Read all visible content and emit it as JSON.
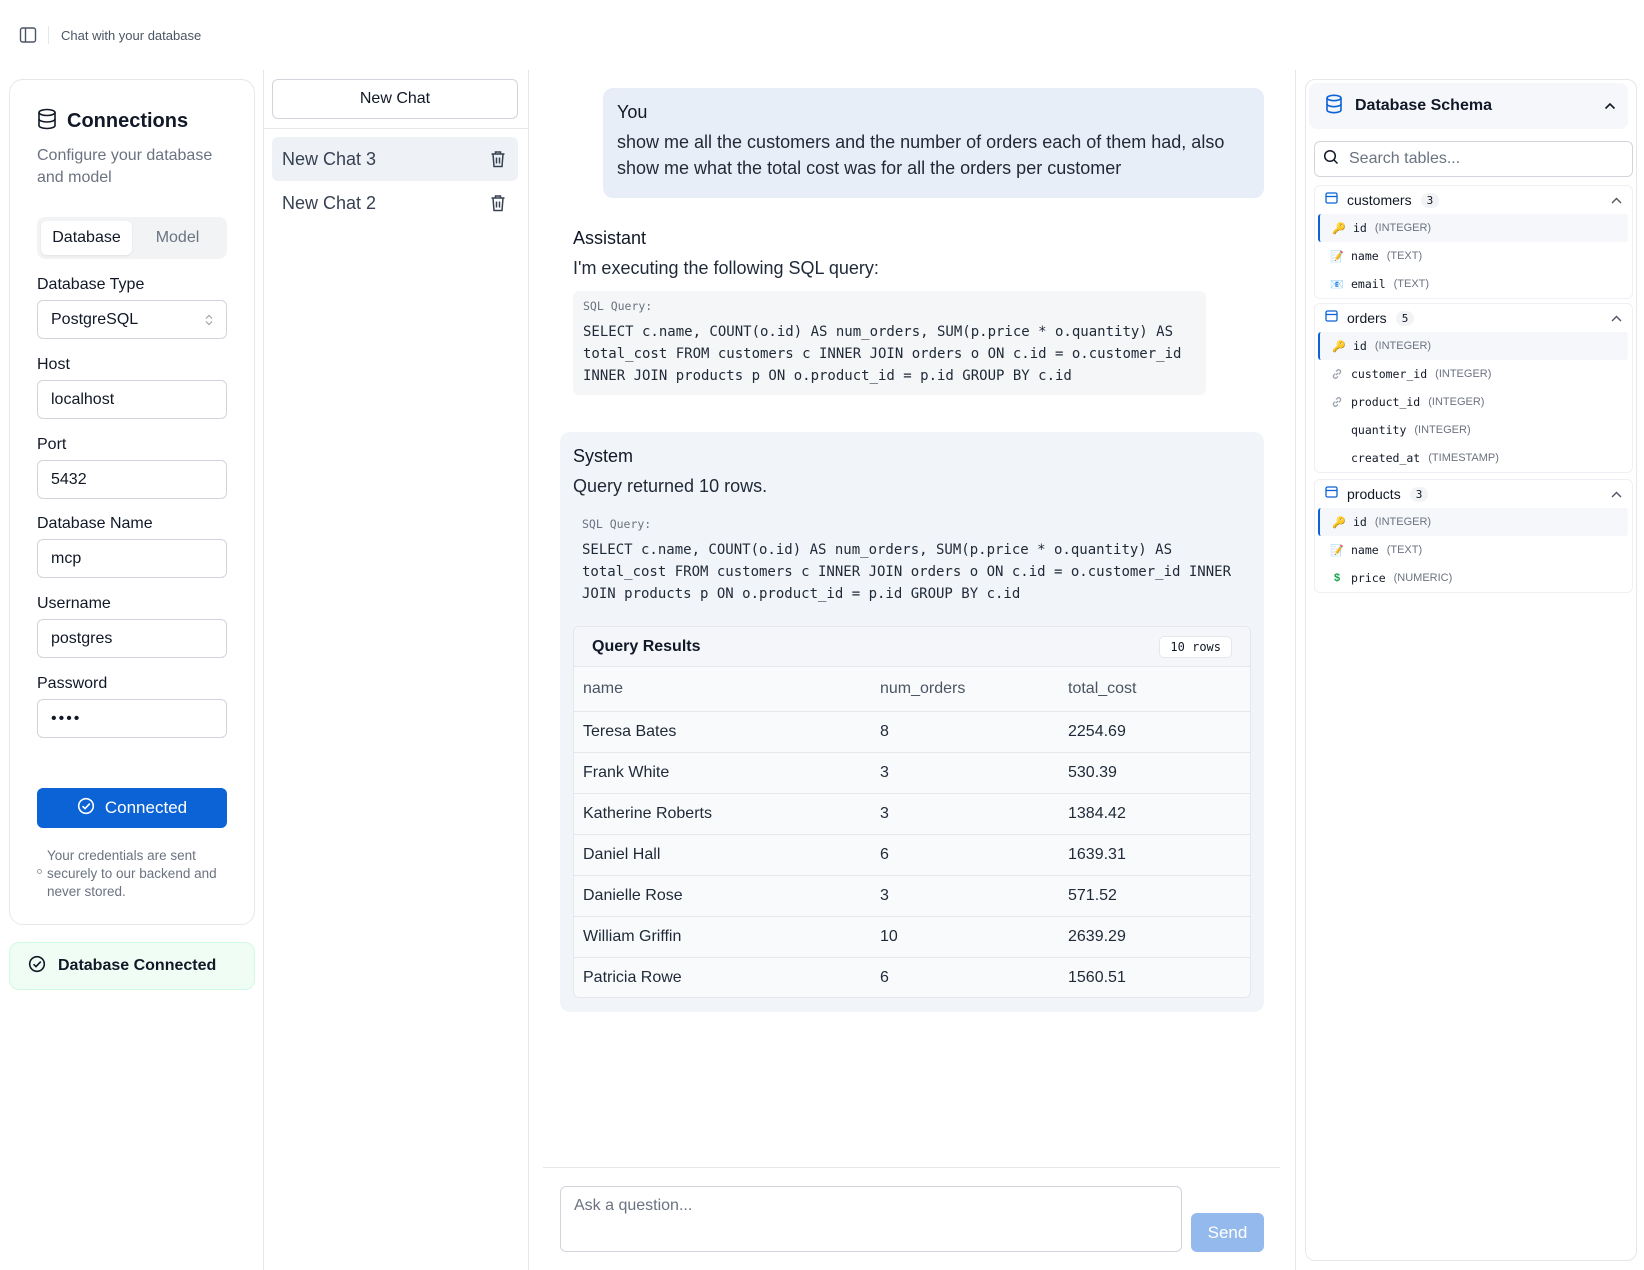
{
  "app": {
    "title": "Chat with your database"
  },
  "connections": {
    "title": "Connections",
    "subtitle": "Configure your database and model",
    "tabs": [
      "Database",
      "Model"
    ],
    "fields": {
      "db_type_label": "Database Type",
      "db_type_value": "PostgreSQL",
      "host_label": "Host",
      "host_value": "localhost",
      "port_label": "Port",
      "port_value": "5432",
      "dbname_label": "Database Name",
      "dbname_value": "mcp",
      "user_label": "Username",
      "user_value": "postgres",
      "password_label": "Password",
      "password_value": "••••"
    },
    "connect_button": "Connected",
    "note": "Your credentials are sent securely to our backend and never stored.",
    "status": "Database Connected"
  },
  "chat_list": {
    "new_chat": "New Chat",
    "items": [
      {
        "label": "New Chat 3"
      },
      {
        "label": "New Chat 2"
      }
    ]
  },
  "messages": {
    "user": {
      "who": "You",
      "body": "show me all the customers and the number of orders each of them had, also show me what the total cost was for all the orders per customer"
    },
    "assistant": {
      "who": "Assistant",
      "text": "I'm executing the following SQL query:",
      "code_label": "SQL Query:",
      "sql": "SELECT c.name, COUNT(o.id) AS num_orders, SUM(p.price * o.quantity) AS\ntotal_cost FROM customers c INNER JOIN orders o ON c.id = o.customer_id\nINNER JOIN products p ON o.product_id = p.id GROUP BY c.id"
    },
    "system": {
      "who": "System",
      "text": "Query returned 10 rows.",
      "code_label": "SQL Query:",
      "sql": "SELECT c.name, COUNT(o.id) AS num_orders, SUM(p.price * o.quantity) AS\ntotal_cost FROM customers c INNER JOIN orders o ON c.id = o.customer_id INNER\nJOIN products p ON o.product_id = p.id GROUP BY c.id",
      "results_title": "Query Results",
      "row_badge": "10 rows",
      "columns": [
        "name",
        "num_orders",
        "total_cost"
      ],
      "rows": [
        [
          "Teresa Bates",
          "8",
          "2254.69"
        ],
        [
          "Frank White",
          "3",
          "530.39"
        ],
        [
          "Katherine Roberts",
          "3",
          "1384.42"
        ],
        [
          "Daniel Hall",
          "6",
          "1639.31"
        ],
        [
          "Danielle Rose",
          "3",
          "571.52"
        ],
        [
          "William Griffin",
          "10",
          "2639.29"
        ],
        [
          "Patricia Rowe",
          "6",
          "1560.51"
        ]
      ]
    }
  },
  "composer": {
    "placeholder": "Ask a question...",
    "send": "Send"
  },
  "schema": {
    "title": "Database Schema",
    "search_placeholder": "Search tables...",
    "tables": [
      {
        "name": "customers",
        "count": "3",
        "columns": [
          {
            "name": "id",
            "type": "(INTEGER)",
            "icon": "key-icon"
          },
          {
            "name": "name",
            "type": "(TEXT)",
            "icon": "text-icon"
          },
          {
            "name": "email",
            "type": "(TEXT)",
            "icon": "mail-icon"
          }
        ]
      },
      {
        "name": "orders",
        "count": "5",
        "columns": [
          {
            "name": "id",
            "type": "(INTEGER)",
            "icon": "key-icon"
          },
          {
            "name": "customer_id",
            "type": "(INTEGER)",
            "icon": "link-icon"
          },
          {
            "name": "product_id",
            "type": "(INTEGER)",
            "icon": "link-icon"
          },
          {
            "name": "quantity",
            "type": "(INTEGER)",
            "icon": ""
          },
          {
            "name": "created_at",
            "type": "(TIMESTAMP)",
            "icon": ""
          }
        ]
      },
      {
        "name": "products",
        "count": "3",
        "columns": [
          {
            "name": "id",
            "type": "(INTEGER)",
            "icon": "key-icon"
          },
          {
            "name": "name",
            "type": "(TEXT)",
            "icon": "text-icon"
          },
          {
            "name": "price",
            "type": "(NUMERIC)",
            "icon": "dollar-icon"
          }
        ]
      }
    ]
  },
  "colors": {
    "primary": "#0b63d6",
    "send_disabled": "#94b9ec",
    "status_bg": "#f0fdf4"
  }
}
